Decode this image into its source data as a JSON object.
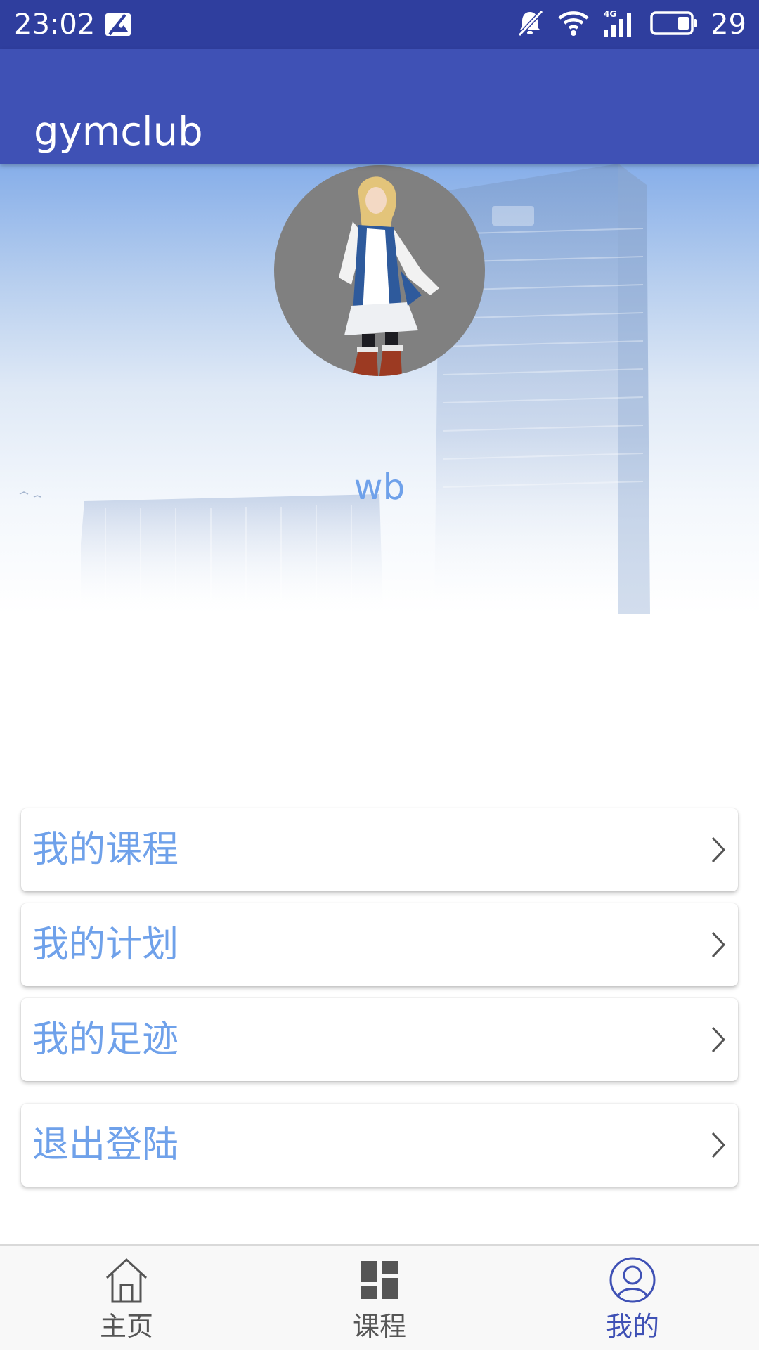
{
  "status_bar": {
    "time": "23:02",
    "battery_level": "29",
    "icons": [
      "photo-icon",
      "silent-bell-icon",
      "wifi-icon",
      "signal-4g-icon",
      "battery-icon"
    ]
  },
  "app_bar": {
    "title": "gymclub"
  },
  "profile": {
    "username": "wb"
  },
  "menu": [
    {
      "label": "我的课程",
      "icon": "chevron-right-icon"
    },
    {
      "label": "我的计划",
      "icon": "chevron-right-icon"
    },
    {
      "label": "我的足迹",
      "icon": "chevron-right-icon"
    },
    {
      "label": "退出登陆",
      "icon": "chevron-right-icon"
    }
  ],
  "bottom_nav": [
    {
      "label": "主页",
      "icon": "home-icon",
      "active": false
    },
    {
      "label": "课程",
      "icon": "grid-icon",
      "active": false
    },
    {
      "label": "我的",
      "icon": "profile-icon",
      "active": true
    }
  ],
  "colors": {
    "status_bar": "#2f3e9e",
    "app_bar": "#3f51b5",
    "accent_text": "#6fa1ea",
    "nav_active": "#3f51b5",
    "nav_inactive": "#555555"
  }
}
